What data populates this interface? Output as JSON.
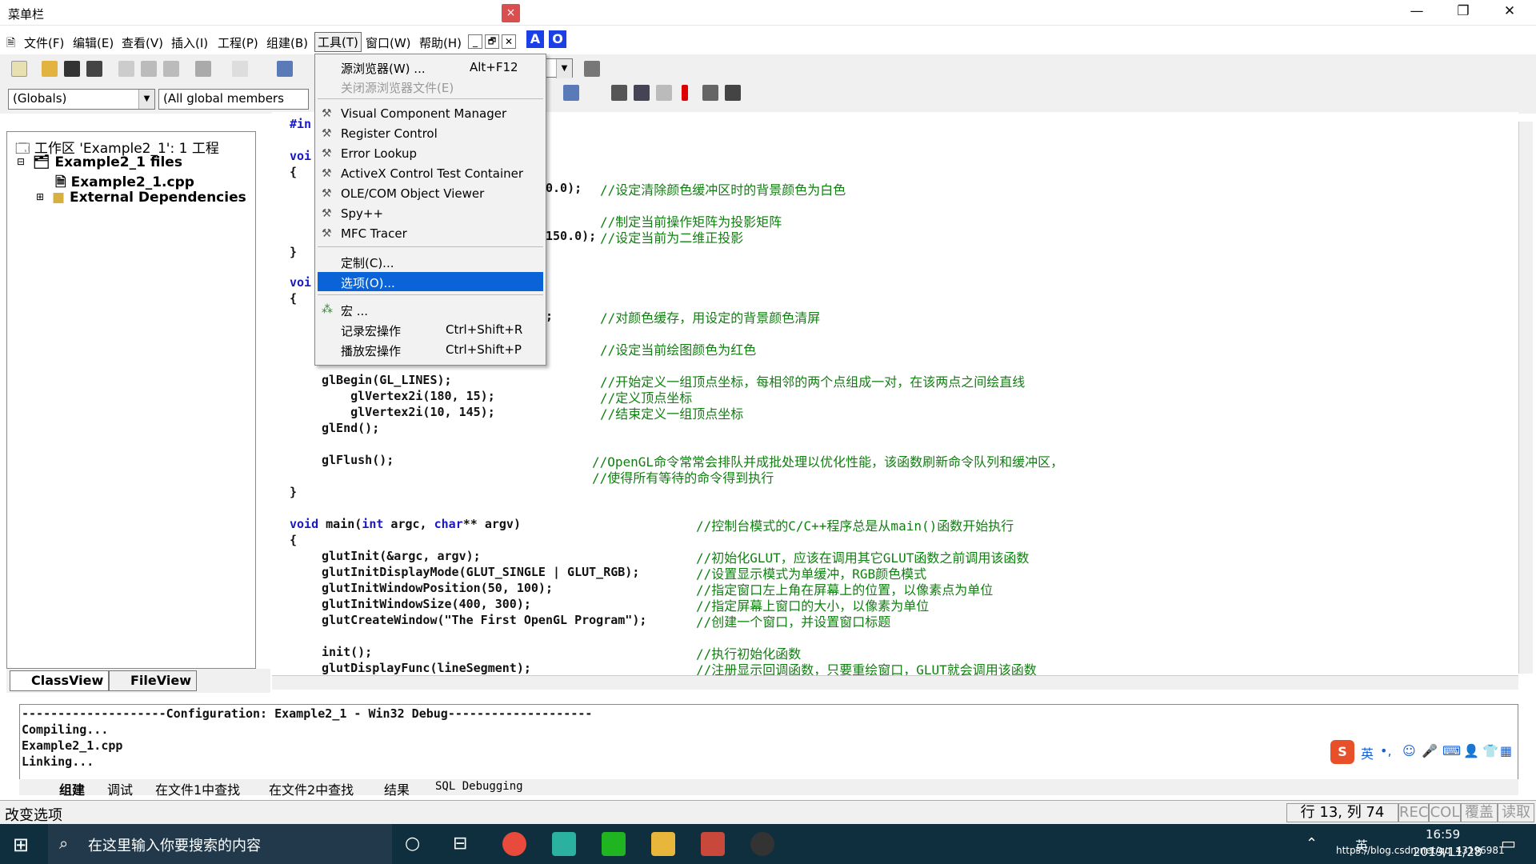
{
  "window": {
    "title": "菜单栏",
    "min": "—",
    "restore": "❐",
    "close": "✕",
    "inner_close": "×"
  },
  "menubar": [
    "文件(F)",
    "编辑(E)",
    "查看(V)",
    "插入(I)",
    "工程(P)",
    "组建(B)",
    "工具(T)",
    "窗口(W)",
    "帮助(H)"
  ],
  "mdi_buttons": [
    "_",
    "🗗",
    "✕"
  ],
  "ab_buttons": [
    "A",
    "O"
  ],
  "combos": {
    "globals": "(Globals)",
    "members": "(All global members"
  },
  "workspace": {
    "root": "工作区 'Example2_1': 1 工程",
    "project": "Example2_1 files",
    "file": "Example2_1.cpp",
    "deps": "External Dependencies"
  },
  "tabs": {
    "classview": "ClassView",
    "fileview": "FileView"
  },
  "tools_menu": [
    {
      "label": "源浏览器(W) ...",
      "shortcut": "Alt+F12"
    },
    {
      "label": "关闭源浏览器文件(E)",
      "disabled": true
    },
    {
      "label": "Visual Component Manager"
    },
    {
      "label": "Register Control"
    },
    {
      "label": "Error Lookup"
    },
    {
      "label": "ActiveX Control Test Container"
    },
    {
      "label": "OLE/COM Object Viewer"
    },
    {
      "label": "Spy++"
    },
    {
      "label": "MFC Tracer"
    },
    {
      "label": "定制(C)..."
    },
    {
      "label": "选项(O)...",
      "highlighted": true
    },
    {
      "label": "宏 ..."
    },
    {
      "label": "记录宏操作",
      "shortcut": "Ctrl+Shift+R"
    },
    {
      "label": "播放宏操作",
      "shortcut": "Ctrl+Shift+P"
    }
  ],
  "code": {
    "l1": "#in",
    "l2a": "voi",
    "l2b": "{",
    "l3": "0.0);",
    "l4": "150.0);",
    "l5": "}",
    "l6a": "voi",
    "l6b": "{",
    "l7": ";",
    "l8": "glBegin(GL_LINES);",
    "l9": "    glVertex2i(180, 15);",
    "l10": "    glVertex2i(10, 145);",
    "l11": "glEnd();",
    "l12": "glFlush();",
    "l13": "}",
    "main_kw": "void",
    "main_rest": " main(",
    "main_int": "int",
    "main_rest2": " argc, ",
    "main_char": "char",
    "main_rest3": "** argv)",
    "l15": "{",
    "l16": "glutInit(&argc, argv);",
    "l17": "glutInitDisplayMode(GLUT_SINGLE | GLUT_RGB);",
    "l18": "glutInitWindowPosition(50, 100);",
    "l19": "glutInitWindowSize(400, 300);",
    "l20": "glutCreateWindow(\"The First OpenGL Program\");",
    "l21": "init();",
    "l22": "glutDisplayFunc(lineSegment);"
  },
  "comments": {
    "c1": "//设定清除颜色缓冲区时的背景颜色为白色",
    "c2": "//制定当前操作矩阵为投影矩阵",
    "c3": "//设定当前为二维正投影",
    "c4": "//对颜色缓存，用设定的背景颜色清屏",
    "c5": "//设定当前绘图颜色为红色",
    "c6": "//开始定义一组顶点坐标，每相邻的两个点组成一对，在该两点之间绘直线",
    "c7": "//定义顶点坐标",
    "c8": "//结束定义一组顶点坐标",
    "c9": "//OpenGL命令常常会排队并成批处理以优化性能，该函数刷新命令队列和缓冲区，",
    "c10": "//使得所有等待的命令得到执行",
    "c11": "//控制台模式的C/C++程序总是从main()函数开始执行",
    "c12": "//初始化GLUT，应该在调用其它GLUT函数之前调用该函数",
    "c13": "//设置显示模式为单缓冲，RGB颜色模式",
    "c14": "//指定窗口左上角在屏幕上的位置，以像素点为单位",
    "c15": "//指定屏幕上窗口的大小，以像素为单位",
    "c16": "//创建一个窗口，并设置窗口标题",
    "c17": "//执行初始化函数",
    "c18": "//注册显示回调函数，只要重绘窗口，GLUT就会调用该函数"
  },
  "output": {
    "config": "--------------------Configuration: Example2_1 - Win32 Debug--------------------",
    "compiling": "Compiling...",
    "file": "Example2_1.cpp",
    "linking": "Linking..."
  },
  "output_tabs": [
    "组建",
    "调试",
    "在文件1中查找",
    "在文件2中查找",
    "结果",
    "SQL Debugging"
  ],
  "status": {
    "left": "改变选项",
    "pos": "行 13, 列 74",
    "rec": "REC",
    "col": "COL",
    "ovr": "覆盖",
    "read": "读取"
  },
  "ime": {
    "lang": "英",
    "punct": "•,"
  },
  "taskbar": {
    "search": "在这里输入你要搜索的内容",
    "time": "16:59",
    "date": "2019/11/28",
    "tray_lang": "英",
    "watermark": "https://blog.csdn.net/qq_43196981"
  },
  "colors": {
    "highlight": "#0a64d8",
    "comment": "#108010",
    "keyword": "#1818c8",
    "taskbar": "#0f2f3f"
  }
}
